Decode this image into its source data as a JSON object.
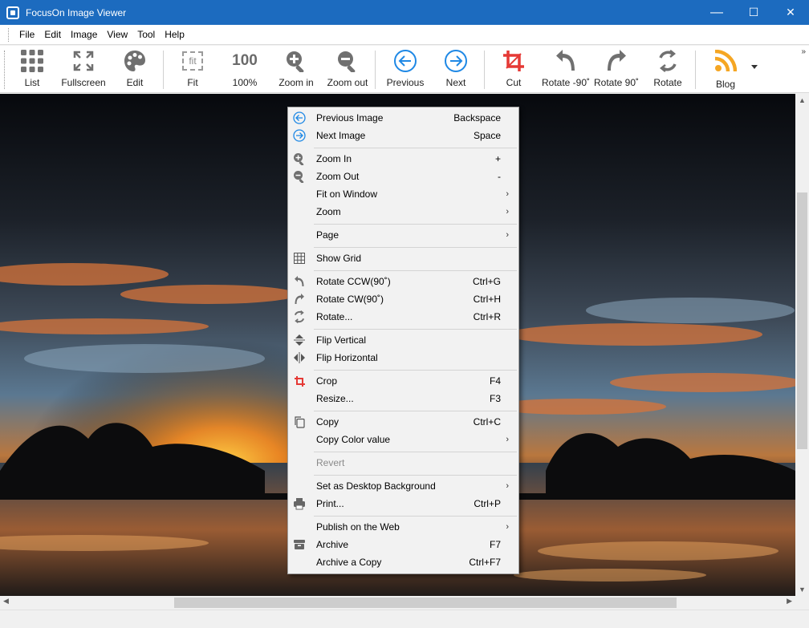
{
  "window": {
    "title": "FocusOn Image Viewer",
    "minimize": "—",
    "maximize": "☐",
    "close": "✕"
  },
  "menubar": [
    "File",
    "Edit",
    "Image",
    "View",
    "Tool",
    "Help"
  ],
  "toolbar": {
    "list": "List",
    "fullscreen": "Fullscreen",
    "edit": "Edit",
    "fit": "Fit",
    "fit_icon_text": "fit",
    "hundred": "100%",
    "hundred_icon_text": "100",
    "zoom_in": "Zoom in",
    "zoom_out": "Zoom out",
    "previous": "Previous",
    "next": "Next",
    "cut": "Cut",
    "rotate_ccw": "Rotate -90˚",
    "rotate_cw": "Rotate 90˚",
    "rotate": "Rotate",
    "blog": "Blog",
    "more": "»"
  },
  "context_menu": {
    "previous_image": {
      "label": "Previous Image",
      "shortcut": "Backspace"
    },
    "next_image": {
      "label": "Next Image",
      "shortcut": "Space"
    },
    "zoom_in": {
      "label": "Zoom In",
      "shortcut": "+"
    },
    "zoom_out": {
      "label": "Zoom Out",
      "shortcut": "-"
    },
    "fit_on_window": {
      "label": "Fit on Window"
    },
    "zoom": {
      "label": "Zoom"
    },
    "page": {
      "label": "Page"
    },
    "show_grid": {
      "label": "Show Grid"
    },
    "rotate_ccw": {
      "label": "Rotate CCW(90˚)",
      "shortcut": "Ctrl+G"
    },
    "rotate_cw": {
      "label": "Rotate CW(90˚)",
      "shortcut": "Ctrl+H"
    },
    "rotate": {
      "label": "Rotate...",
      "shortcut": "Ctrl+R"
    },
    "flip_vertical": {
      "label": "Flip Vertical"
    },
    "flip_horizontal": {
      "label": "Flip Horizontal"
    },
    "crop": {
      "label": "Crop",
      "shortcut": "F4"
    },
    "resize": {
      "label": "Resize...",
      "shortcut": "F3"
    },
    "copy": {
      "label": "Copy",
      "shortcut": "Ctrl+C"
    },
    "copy_color": {
      "label": "Copy Color value"
    },
    "revert": {
      "label": "Revert"
    },
    "desktop_bg": {
      "label": "Set as Desktop Background"
    },
    "print": {
      "label": "Print...",
      "shortcut": "Ctrl+P"
    },
    "publish": {
      "label": "Publish on the Web"
    },
    "archive": {
      "label": "Archive",
      "shortcut": "F7"
    },
    "archive_copy": {
      "label": "Archive a Copy",
      "shortcut": "Ctrl+F7"
    },
    "submenu_arrow": "›"
  },
  "colors": {
    "titlebar": "#1c6bbf",
    "accent_blue": "#1e88e5",
    "crop_red": "#e53935",
    "blog_orange": "#f5a623"
  }
}
